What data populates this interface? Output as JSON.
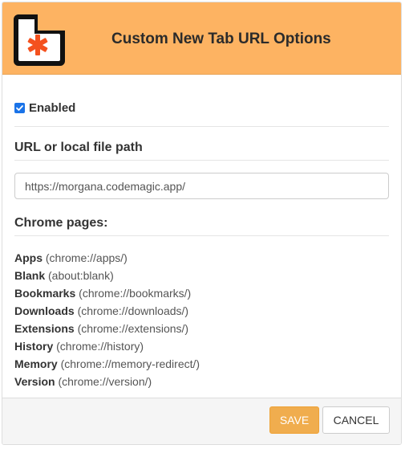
{
  "header": {
    "title": "Custom New Tab URL Options",
    "logo_icon": "asterisk-page-icon",
    "colors": {
      "background": "#fdb362",
      "logo_frame": "#111111",
      "logo_asterisk": "#f4511e"
    }
  },
  "settings": {
    "enabled": {
      "checked": true,
      "label": "Enabled"
    },
    "url_section": {
      "heading": "URL or local file path",
      "value": "https://morgana.codemagic.app/"
    },
    "chrome_pages": {
      "heading": "Chrome pages:",
      "items": [
        {
          "name": "Apps",
          "url": "(chrome://apps/)"
        },
        {
          "name": "Blank",
          "url": "(about:blank)"
        },
        {
          "name": "Bookmarks",
          "url": "(chrome://bookmarks/)"
        },
        {
          "name": "Downloads",
          "url": "(chrome://downloads/)"
        },
        {
          "name": "Extensions",
          "url": "(chrome://extensions/)"
        },
        {
          "name": "History",
          "url": "(chrome://history)"
        },
        {
          "name": "Memory",
          "url": "(chrome://memory-redirect/)"
        },
        {
          "name": "Version",
          "url": "(chrome://version/)"
        }
      ]
    }
  },
  "footer": {
    "save_label": "SAVE",
    "cancel_label": "CANCEL",
    "colors": {
      "save": "#f0ad4e",
      "cancel": "#ffffff"
    }
  }
}
